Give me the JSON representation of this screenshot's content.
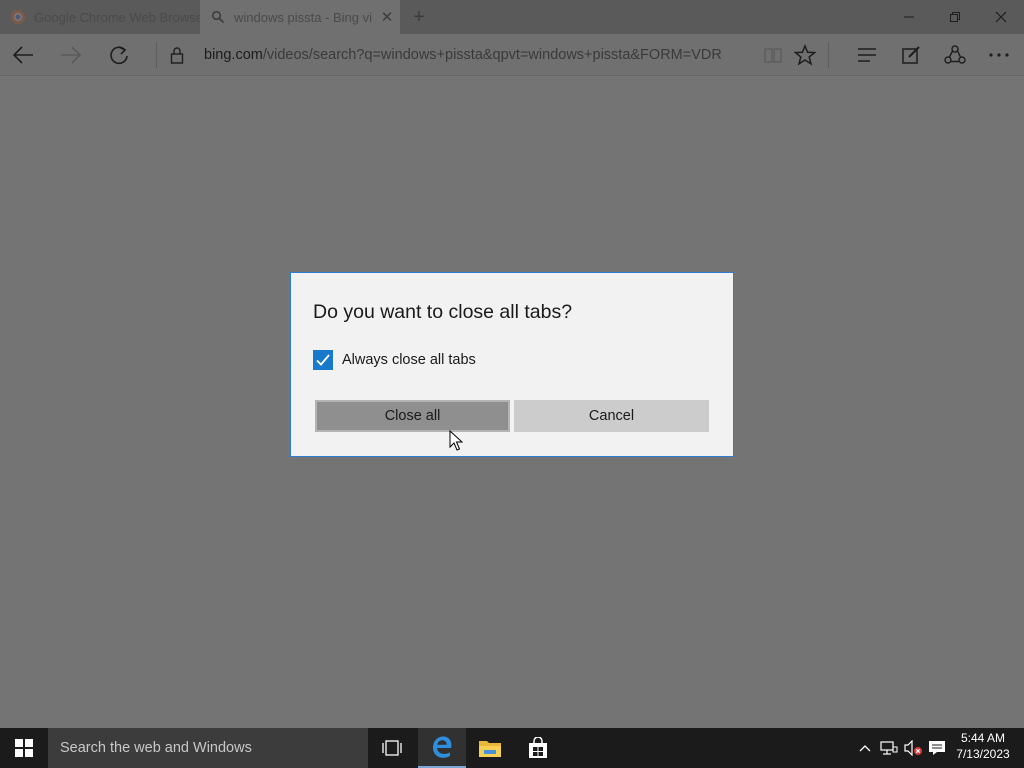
{
  "browser": {
    "tabs": [
      {
        "label": "Google Chrome Web Browse",
        "favicon": "chrome-icon"
      },
      {
        "label": "windows pissta - Bing vi",
        "favicon": "search-icon"
      }
    ],
    "address": {
      "domain": "bing.com",
      "path": "/videos/search?q=windows+pissta&qpvt=windows+pissta&FORM=VDR"
    }
  },
  "dialog": {
    "title": "Do you want to close all tabs?",
    "checkbox_label": "Always close all tabs",
    "checkbox_checked": true,
    "primary_button": "Close all",
    "secondary_button": "Cancel"
  },
  "taskbar": {
    "search_placeholder": "Search the web and Windows",
    "time": "5:44 AM",
    "date": "7/13/2023"
  },
  "colors": {
    "accent": "#1979ca",
    "dialog_border": "#2b7cd3"
  }
}
